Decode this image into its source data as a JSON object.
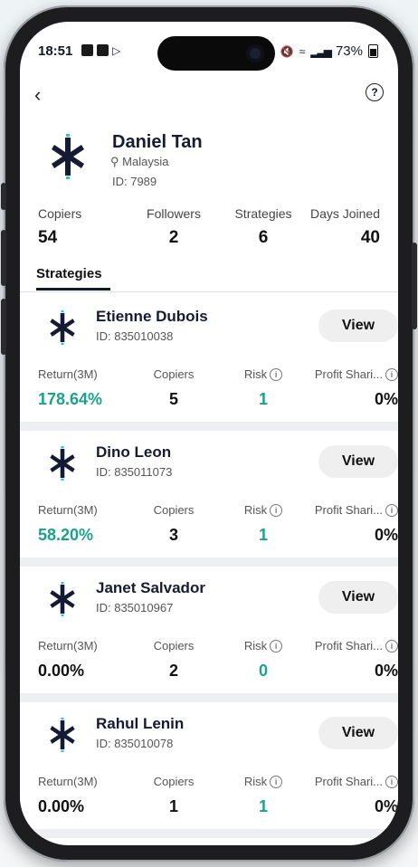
{
  "status_bar": {
    "time": "18:51",
    "battery": "73%"
  },
  "profile": {
    "name": "Daniel Tan",
    "location": "Malaysia",
    "id": "ID: 7989"
  },
  "stats": [
    {
      "label": "Copiers",
      "value": "54"
    },
    {
      "label": "Followers",
      "value": "2"
    },
    {
      "label": "Strategies",
      "value": "6"
    },
    {
      "label": "Days Joined",
      "value": "40"
    }
  ],
  "tabs": {
    "active": "Strategies"
  },
  "strategies": [
    {
      "name": "Etienne Dubois",
      "id": "ID: 835010038",
      "view": "View",
      "return_label": "Return(3M)",
      "return": "178.64%",
      "copiers_label": "Copiers",
      "copiers": "5",
      "risk_label": "Risk",
      "risk": "1",
      "profit_label": "Profit Shari...",
      "profit": "0%"
    },
    {
      "name": "Dino Leon",
      "id": "ID: 835011073",
      "view": "View",
      "return_label": "Return(3M)",
      "return": "58.20%",
      "copiers_label": "Copiers",
      "copiers": "3",
      "risk_label": "Risk",
      "risk": "1",
      "profit_label": "Profit Shari...",
      "profit": "0%"
    },
    {
      "name": "Janet Salvador",
      "id": "ID: 835010967",
      "view": "View",
      "return_label": "Return(3M)",
      "return": "0.00%",
      "copiers_label": "Copiers",
      "copiers": "2",
      "risk_label": "Risk",
      "risk": "0",
      "profit_label": "Profit Shari...",
      "profit": "0%"
    },
    {
      "name": "Rahul Lenin",
      "id": "ID: 835010078",
      "view": "View",
      "return_label": "Return(3M)",
      "return": "0.00%",
      "copiers_label": "Copiers",
      "copiers": "1",
      "risk_label": "Risk",
      "risk": "1",
      "profit_label": "Profit Shari...",
      "profit": "0%"
    }
  ],
  "colors": {
    "positive": "#1aa38a",
    "brand_dark": "#141b33",
    "brand_accent": "#2ec4c4"
  },
  "icons": {
    "back": "chevron-left-icon",
    "help": "question-circle-icon",
    "location": "pin-icon",
    "info": "info-icon"
  }
}
